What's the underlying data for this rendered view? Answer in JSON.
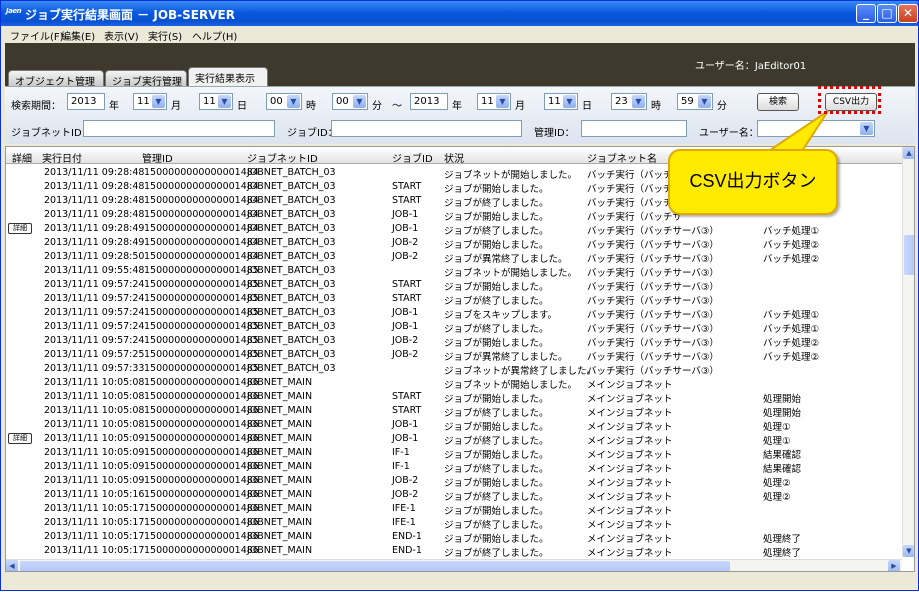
{
  "window": {
    "app_icon": "Jaen",
    "title": "ジョブ実行結果画面 － JOB-SERVER"
  },
  "menu": [
    "ファイル(F)",
    "編集(E)",
    "表示(V)",
    "実行(S)",
    "ヘルプ(H)"
  ],
  "header": {
    "user_label": "ユーザー名：",
    "user_value": "JaEditor01"
  },
  "tabs": [
    "オブジェクト管理",
    "ジョブ実行管理",
    "実行結果表示"
  ],
  "filter": {
    "period_label": "検索期間：",
    "from": {
      "year": "2013",
      "month": "11",
      "day": "11",
      "hour": "00",
      "minute": "00"
    },
    "to": {
      "year": "2013",
      "month": "11",
      "day": "11",
      "hour": "23",
      "minute": "59"
    },
    "unit_year": "年",
    "unit_month": "月",
    "unit_day": "日",
    "unit_hour": "時",
    "unit_minute": "分",
    "range_sep": "～",
    "search_button": "検索",
    "csv_button": "CSV出力",
    "jobnet_id_label": "ジョブネットID：",
    "job_id_label": "ジョブID：",
    "manage_id_label": "管理ID：",
    "user_label": "ユーザー名："
  },
  "grid": {
    "columns": [
      "詳細",
      "実行日付",
      "管理ID",
      "ジョブネットID",
      "ジョブID",
      "状況",
      "ジョブネット名"
    ],
    "detail_label": "詳細",
    "rows": [
      {
        "d": false,
        "date": "2013/11/11 09:28:48",
        "mid": "1500000000000001484",
        "jnid": "JOBNET_BATCH_03",
        "jid": "",
        "st": "ジョブネットが開始しました。",
        "jnn": "バッチ実行（バッチ",
        "ex": ""
      },
      {
        "d": false,
        "date": "2013/11/11 09:28:48",
        "mid": "1500000000000001484",
        "jnid": "JOBNET_BATCH_03",
        "jid": "START",
        "st": "ジョブが開始しました。",
        "jnn": "バッチ実行（バッチ",
        "ex": ""
      },
      {
        "d": false,
        "date": "2013/11/11 09:28:48",
        "mid": "1500000000000001484",
        "jnid": "JOBNET_BATCH_03",
        "jid": "START",
        "st": "ジョブが終了しました。",
        "jnn": "バッチ実行（バッチ",
        "ex": ""
      },
      {
        "d": false,
        "date": "2013/11/11 09:28:48",
        "mid": "1500000000000001484",
        "jnid": "JOBNET_BATCH_03",
        "jid": "JOB-1",
        "st": "ジョブが開始しました。",
        "jnn": "バッチ実行（バッチサ",
        "ex": ""
      },
      {
        "d": true,
        "date": "2013/11/11 09:28:49",
        "mid": "1500000000000001484",
        "jnid": "JOBNET_BATCH_03",
        "jid": "JOB-1",
        "st": "ジョブが終了しました。",
        "jnn": "バッチ実行（バッチサーバ③）",
        "ex": "バッチ処理①"
      },
      {
        "d": false,
        "date": "2013/11/11 09:28:49",
        "mid": "1500000000000001484",
        "jnid": "JOBNET_BATCH_03",
        "jid": "JOB-2",
        "st": "ジョブが開始しました。",
        "jnn": "バッチ実行（バッチサーバ③）",
        "ex": "バッチ処理②"
      },
      {
        "d": false,
        "date": "2013/11/11 09:28:50",
        "mid": "1500000000000001484",
        "jnid": "JOBNET_BATCH_03",
        "jid": "JOB-2",
        "st": "ジョブが異常終了しました。",
        "jnn": "バッチ実行（バッチサーバ③）",
        "ex": "バッチ処理②"
      },
      {
        "d": false,
        "date": "2013/11/11 09:55:48",
        "mid": "1500000000000001485",
        "jnid": "JOBNET_BATCH_03",
        "jid": "",
        "st": "ジョブネットが開始しました。",
        "jnn": "バッチ実行（バッチサーバ③）",
        "ex": ""
      },
      {
        "d": false,
        "date": "2013/11/11 09:57:24",
        "mid": "1500000000000001485",
        "jnid": "JOBNET_BATCH_03",
        "jid": "START",
        "st": "ジョブが開始しました。",
        "jnn": "バッチ実行（バッチサーバ③）",
        "ex": ""
      },
      {
        "d": false,
        "date": "2013/11/11 09:57:24",
        "mid": "1500000000000001485",
        "jnid": "JOBNET_BATCH_03",
        "jid": "START",
        "st": "ジョブが終了しました。",
        "jnn": "バッチ実行（バッチサーバ③）",
        "ex": ""
      },
      {
        "d": false,
        "date": "2013/11/11 09:57:24",
        "mid": "1500000000000001485",
        "jnid": "JOBNET_BATCH_03",
        "jid": "JOB-1",
        "st": "ジョブをスキップします。",
        "jnn": "バッチ実行（バッチサーバ③）",
        "ex": "バッチ処理①"
      },
      {
        "d": false,
        "date": "2013/11/11 09:57:24",
        "mid": "1500000000000001485",
        "jnid": "JOBNET_BATCH_03",
        "jid": "JOB-1",
        "st": "ジョブが終了しました。",
        "jnn": "バッチ実行（バッチサーバ③）",
        "ex": "バッチ処理①"
      },
      {
        "d": false,
        "date": "2013/11/11 09:57:24",
        "mid": "1500000000000001485",
        "jnid": "JOBNET_BATCH_03",
        "jid": "JOB-2",
        "st": "ジョブが開始しました。",
        "jnn": "バッチ実行（バッチサーバ③）",
        "ex": "バッチ処理②"
      },
      {
        "d": false,
        "date": "2013/11/11 09:57:25",
        "mid": "1500000000000001485",
        "jnid": "JOBNET_BATCH_03",
        "jid": "JOB-2",
        "st": "ジョブが異常終了しました。",
        "jnn": "バッチ実行（バッチサーバ③）",
        "ex": "バッチ処理②"
      },
      {
        "d": false,
        "date": "2013/11/11 09:57:33",
        "mid": "1500000000000001485",
        "jnid": "JOBNET_BATCH_03",
        "jid": "",
        "st": "ジョブネットが異常終了しました。",
        "jnn": "バッチ実行（バッチサーバ③）",
        "ex": ""
      },
      {
        "d": false,
        "date": "2013/11/11 10:05:08",
        "mid": "1500000000000001486",
        "jnid": "JOBNET_MAIN",
        "jid": "",
        "st": "ジョブネットが開始しました。",
        "jnn": "メインジョブネット",
        "ex": ""
      },
      {
        "d": false,
        "date": "2013/11/11 10:05:08",
        "mid": "1500000000000001486",
        "jnid": "JOBNET_MAIN",
        "jid": "START",
        "st": "ジョブが開始しました。",
        "jnn": "メインジョブネット",
        "ex": "処理開始"
      },
      {
        "d": false,
        "date": "2013/11/11 10:05:08",
        "mid": "1500000000000001486",
        "jnid": "JOBNET_MAIN",
        "jid": "START",
        "st": "ジョブが終了しました。",
        "jnn": "メインジョブネット",
        "ex": "処理開始"
      },
      {
        "d": false,
        "date": "2013/11/11 10:05:08",
        "mid": "1500000000000001486",
        "jnid": "JOBNET_MAIN",
        "jid": "JOB-1",
        "st": "ジョブが開始しました。",
        "jnn": "メインジョブネット",
        "ex": "処理①"
      },
      {
        "d": true,
        "date": "2013/11/11 10:05:09",
        "mid": "1500000000000001486",
        "jnid": "JOBNET_MAIN",
        "jid": "JOB-1",
        "st": "ジョブが終了しました。",
        "jnn": "メインジョブネット",
        "ex": "処理①"
      },
      {
        "d": false,
        "date": "2013/11/11 10:05:09",
        "mid": "1500000000000001486",
        "jnid": "JOBNET_MAIN",
        "jid": "IF-1",
        "st": "ジョブが開始しました。",
        "jnn": "メインジョブネット",
        "ex": "結果確認"
      },
      {
        "d": false,
        "date": "2013/11/11 10:05:09",
        "mid": "1500000000000001486",
        "jnid": "JOBNET_MAIN",
        "jid": "IF-1",
        "st": "ジョブが終了しました。",
        "jnn": "メインジョブネット",
        "ex": "結果確認"
      },
      {
        "d": false,
        "date": "2013/11/11 10:05:09",
        "mid": "1500000000000001486",
        "jnid": "JOBNET_MAIN",
        "jid": "JOB-2",
        "st": "ジョブが開始しました。",
        "jnn": "メインジョブネット",
        "ex": "処理②"
      },
      {
        "d": false,
        "date": "2013/11/11 10:05:16",
        "mid": "1500000000000001486",
        "jnid": "JOBNET_MAIN",
        "jid": "JOB-2",
        "st": "ジョブが終了しました。",
        "jnn": "メインジョブネット",
        "ex": "処理②"
      },
      {
        "d": false,
        "date": "2013/11/11 10:05:17",
        "mid": "1500000000000001486",
        "jnid": "JOBNET_MAIN",
        "jid": "IFE-1",
        "st": "ジョブが開始しました。",
        "jnn": "メインジョブネット",
        "ex": ""
      },
      {
        "d": false,
        "date": "2013/11/11 10:05:17",
        "mid": "1500000000000001486",
        "jnid": "JOBNET_MAIN",
        "jid": "IFE-1",
        "st": "ジョブが終了しました。",
        "jnn": "メインジョブネット",
        "ex": ""
      },
      {
        "d": false,
        "date": "2013/11/11 10:05:17",
        "mid": "1500000000000001486",
        "jnid": "JOBNET_MAIN",
        "jid": "END-1",
        "st": "ジョブが開始しました。",
        "jnn": "メインジョブネット",
        "ex": "処理終了"
      },
      {
        "d": false,
        "date": "2013/11/11 10:05:17",
        "mid": "1500000000000001486",
        "jnid": "JOBNET_MAIN",
        "jid": "END-1",
        "st": "ジョブが終了しました。",
        "jnn": "メインジョブネット",
        "ex": "処理終了"
      }
    ]
  },
  "callout": "CSV出力ボタン",
  "colors": {
    "callout_fill": "#ffea00",
    "highlight": "#e00000",
    "titlebar": "#0a5ae0",
    "band": "#3d3a2d"
  }
}
